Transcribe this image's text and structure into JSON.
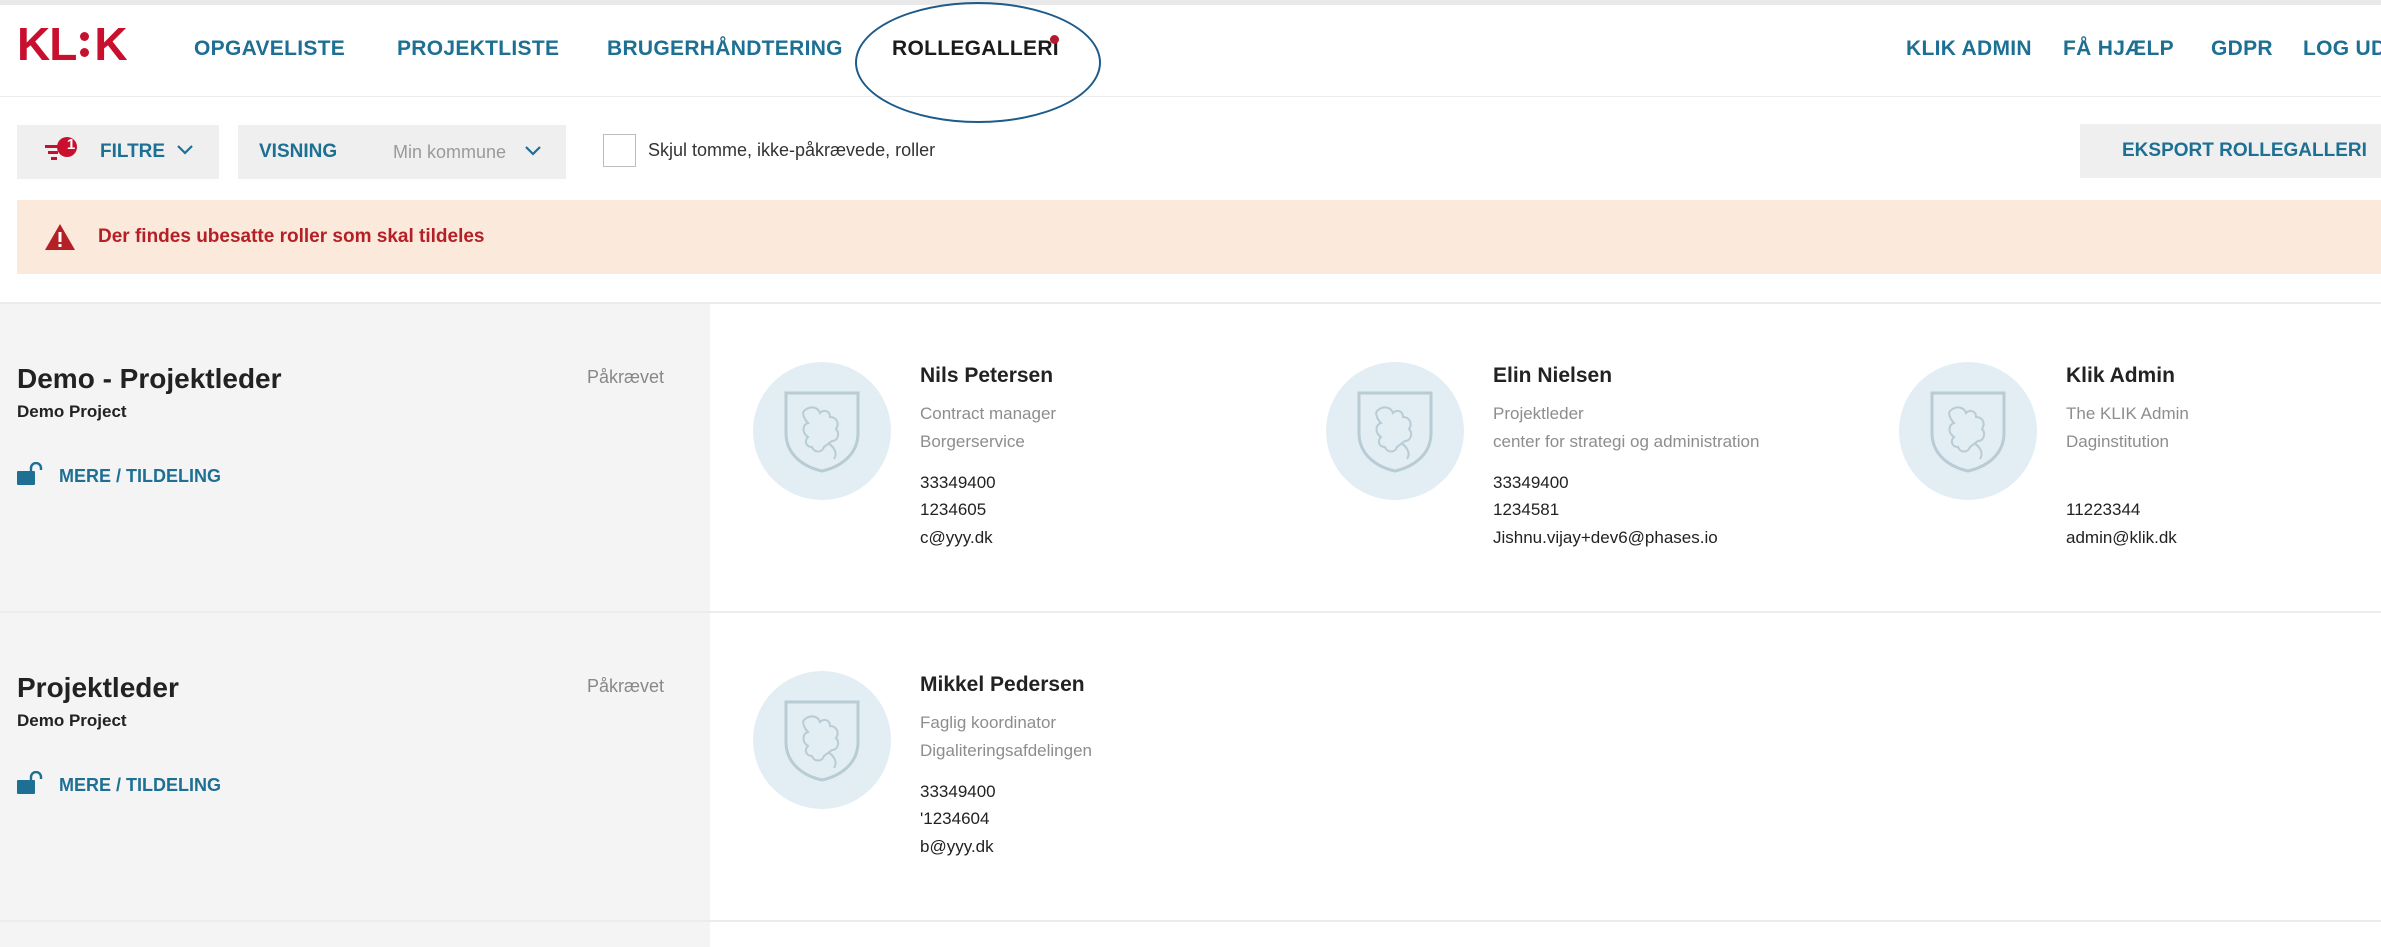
{
  "brand": {
    "logo_left": "KL",
    "logo_right": "K",
    "accent": "#c8102e",
    "link_color": "#1d6f93"
  },
  "nav": {
    "items": [
      {
        "label": "OPGAVELISTE"
      },
      {
        "label": "PROJEKTLISTE"
      },
      {
        "label": "BRUGERHÅNDTERING"
      },
      {
        "label": "ROLLEGALLERI",
        "active": true
      }
    ],
    "right": [
      {
        "label": "KLIK ADMIN"
      },
      {
        "label": "FÅ HJÆLP"
      },
      {
        "label": "GDPR"
      },
      {
        "label": "LOG UD"
      }
    ]
  },
  "toolbar": {
    "filter_badge": "1",
    "filter_label": "FILTRE",
    "view_label": "VISNING",
    "view_value": "Min kommune",
    "hide_checkbox_label": "Skjul tomme, ikke-påkrævede, roller",
    "hide_checked": false,
    "export_label": "EKSPORT ROLLEGALLERI"
  },
  "alert": {
    "text": "Der findes ubesatte roller som skal tildeles"
  },
  "roles": [
    {
      "title": "Demo - Projektleder",
      "project": "Demo Project",
      "required": "Påkrævet",
      "action": "MERE / TILDELING",
      "people": [
        {
          "name": "Nils Petersen",
          "title": "Contract manager",
          "department": "Borgerservice",
          "phone": "33349400",
          "phone2": "1234605",
          "email": "c@yyy.dk"
        },
        {
          "name": "Elin Nielsen",
          "title": "Projektleder",
          "department": "center for strategi og administration",
          "phone": "33349400",
          "phone2": "1234581",
          "email": "Jishnu.vijay+dev6@phases.io"
        },
        {
          "name": "Klik Admin",
          "title": "The KLIK Admin",
          "department": "Daginstitution",
          "phone": "",
          "phone2": "11223344",
          "email": "admin@klik.dk"
        }
      ]
    },
    {
      "title": "Projektleder",
      "project": "Demo Project",
      "required": "Påkrævet",
      "action": "MERE / TILDELING",
      "people": [
        {
          "name": "Mikkel Pedersen",
          "title": "Faglig koordinator",
          "department": "Digaliteringsafdelingen",
          "phone": "33349400",
          "phone2": "'1234604",
          "email": "b@yyy.dk"
        }
      ]
    }
  ]
}
